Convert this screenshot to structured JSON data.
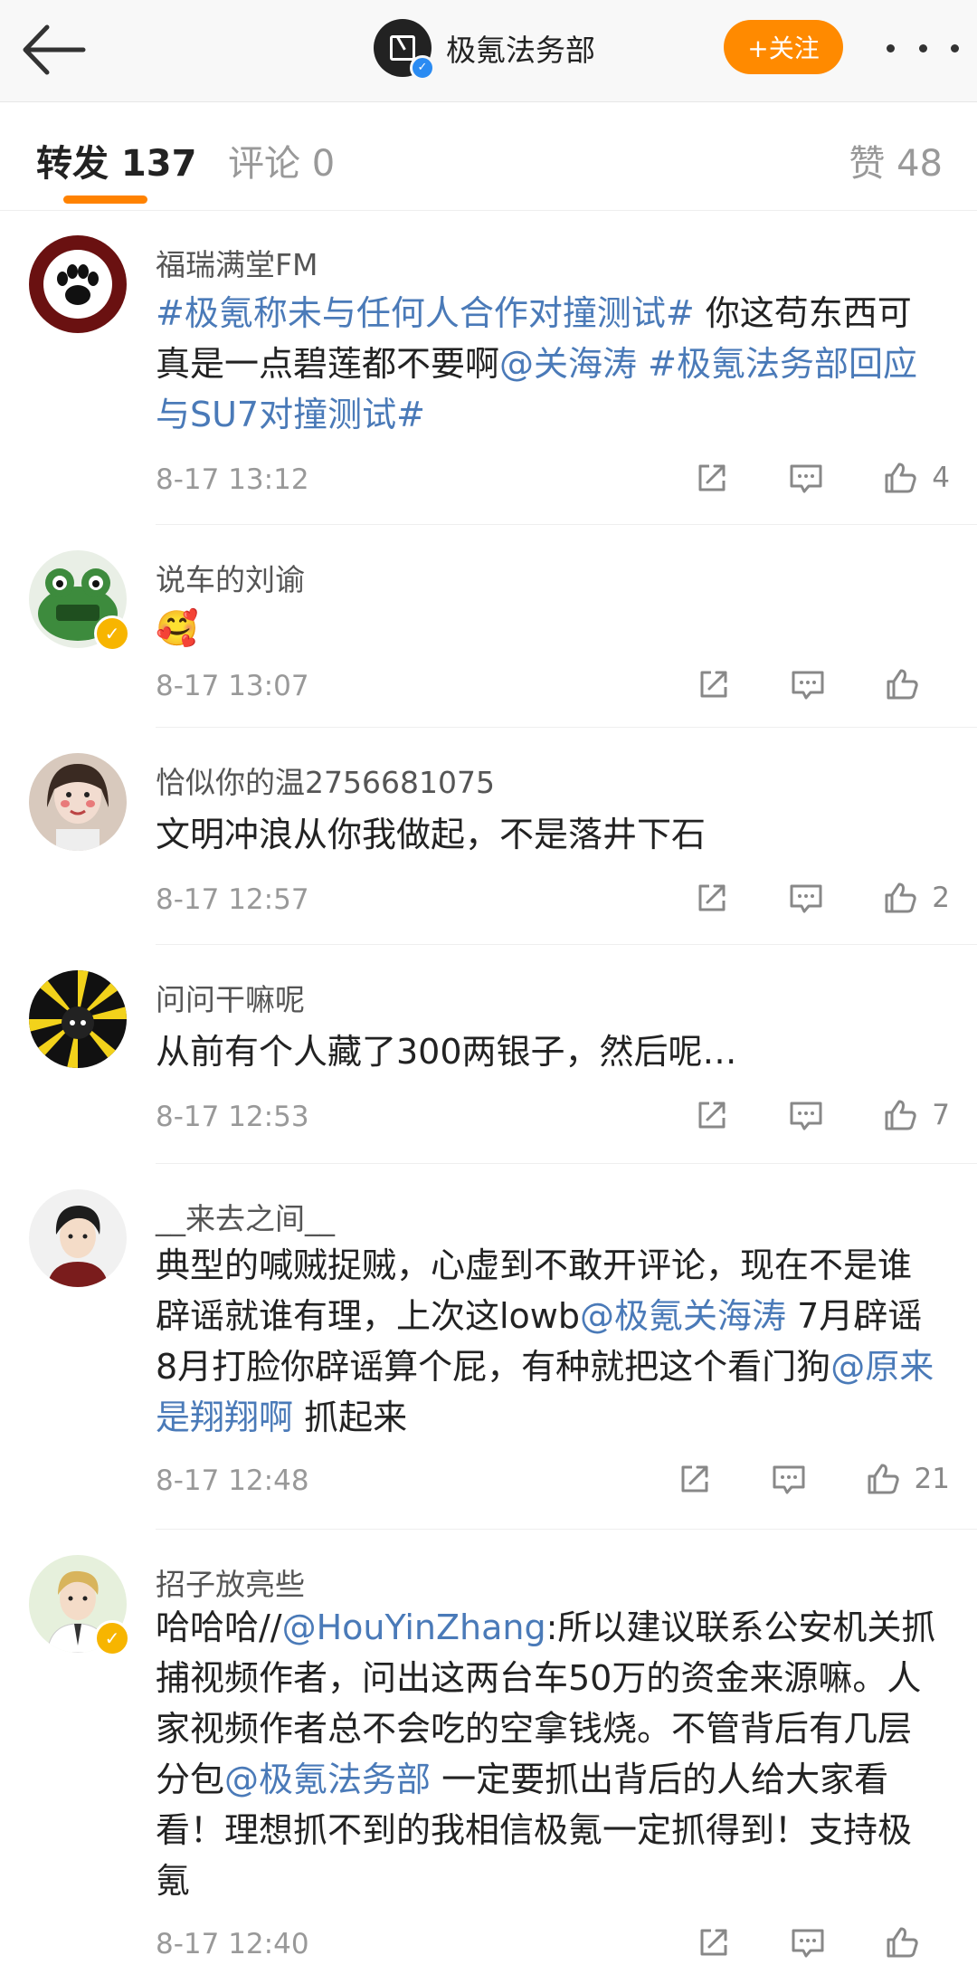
{
  "header": {
    "page_title": "极氪法务部",
    "follow_label": "+关注"
  },
  "tabs": {
    "repost": "转发 137",
    "comment": "评论 0",
    "like": "赞 48"
  },
  "colors": {
    "accent": "#ff8200",
    "link": "#4a7ab8",
    "verified": "#f7b500"
  },
  "comments": [
    {
      "username": "福瑞满堂FM",
      "segments": [
        {
          "t": "#极氪称未与任何人合作对撞测试#",
          "k": "tag"
        },
        {
          "t": " 你这苟东西可真是一点碧莲都不要啊",
          "k": "text"
        },
        {
          "t": "@关海涛",
          "k": "mention"
        },
        {
          "t": " ",
          "k": "text"
        },
        {
          "t": "#极氪法务部回应与SU7对撞测试#",
          "k": "tag"
        }
      ],
      "time": "8-17 13:12",
      "likes": "4",
      "verified": false
    },
    {
      "username": "说车的刘谕",
      "segments": [
        {
          "t": "🥰",
          "k": "text"
        }
      ],
      "time": "8-17 13:07",
      "likes": "",
      "verified": true
    },
    {
      "username": "恰似你的温2756681075",
      "segments": [
        {
          "t": "文明冲浪从你我做起，不是落井下石",
          "k": "text"
        }
      ],
      "time": "8-17 12:57",
      "likes": "2",
      "verified": false
    },
    {
      "username": "问问干嘛呢",
      "segments": [
        {
          "t": "从前有个人藏了300两银子，然后呢…",
          "k": "text"
        }
      ],
      "time": "8-17 12:53",
      "likes": "7",
      "verified": false
    },
    {
      "username": "__来去之间__",
      "segments": [
        {
          "t": "典型的喊贼捉贼，心虚到不敢开评论，现在不是谁辟谣就谁有理，上次这lowb",
          "k": "text"
        },
        {
          "t": "@极氪关海涛",
          "k": "mention"
        },
        {
          "t": " 7月辟谣8月打脸你辟谣算个屁，有种就把这个看门狗",
          "k": "text"
        },
        {
          "t": "@原来是翔翔啊",
          "k": "mention"
        },
        {
          "t": " 抓起来",
          "k": "text"
        }
      ],
      "time": "8-17 12:48",
      "likes": "21",
      "verified": false
    },
    {
      "username": "招子放亮些",
      "segments": [
        {
          "t": "哈哈哈//",
          "k": "text"
        },
        {
          "t": "@HouYinZhang",
          "k": "mention"
        },
        {
          "t": ":所以建议联系公安机关抓捕视频作者，问出这两台车50万的资金来源嘛。人家视频作者总不会吃的空拿钱烧。不管背后有几层分包",
          "k": "text"
        },
        {
          "t": "@极氪法务部",
          "k": "mention"
        },
        {
          "t": " 一定要抓出背后的人给大家看看！理想抓不到的我相信极氪一定抓得到！支持极氪",
          "k": "text"
        }
      ],
      "time": "8-17 12:40",
      "likes": "",
      "verified": true
    }
  ]
}
